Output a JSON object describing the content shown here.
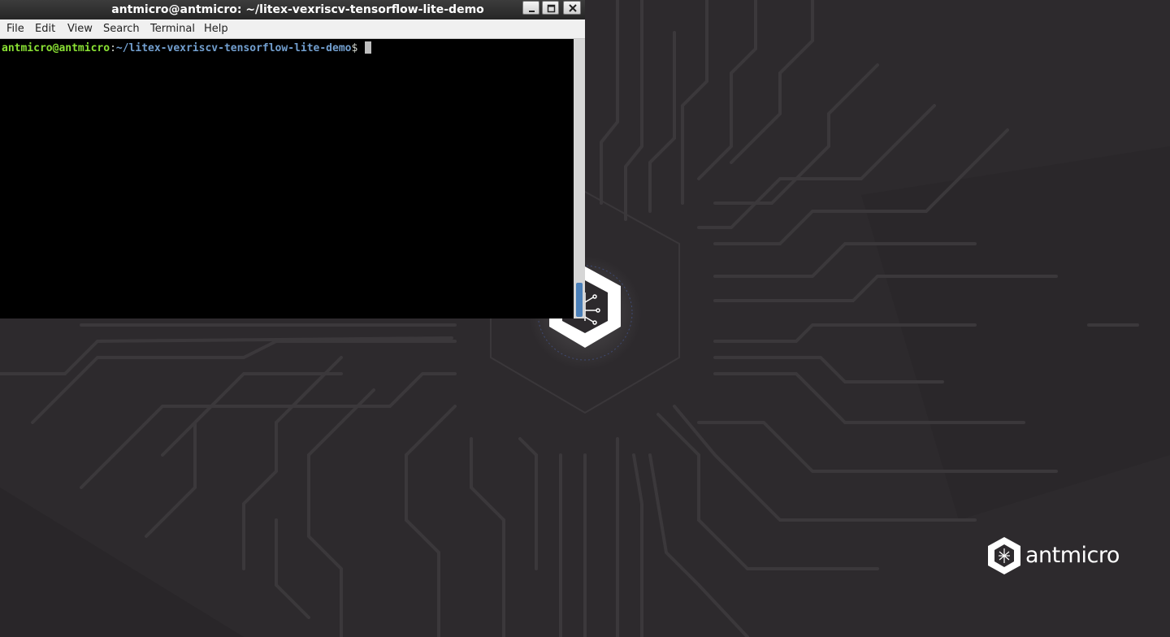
{
  "window": {
    "title": "antmicro@antmicro: ~/litex-vexriscv-tensorflow-lite-demo",
    "buttons": [
      "minimize-icon",
      "maximize-icon",
      "close-icon"
    ]
  },
  "menu": {
    "file": "File",
    "edit": "Edit",
    "view": "View",
    "search": "Search",
    "terminal": "Terminal",
    "help": "Help"
  },
  "terminal": {
    "prompt_user": "antmicro@antmicro",
    "prompt_colon": ":",
    "prompt_path": "~/litex-vexriscv-tensorflow-lite-demo",
    "prompt_symbol": "$"
  },
  "desktop": {
    "brand_name": "antmicro"
  },
  "colors": {
    "desktop_bg": "#2d2a2d",
    "prompt_user": "#8ae234",
    "prompt_path": "#729fcf",
    "scroll_thumb": "#4a7fb8"
  }
}
